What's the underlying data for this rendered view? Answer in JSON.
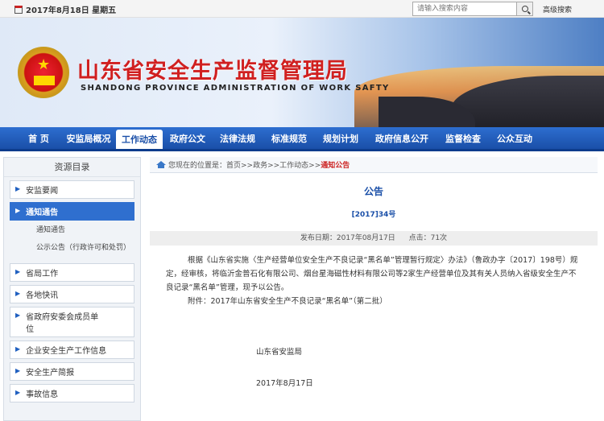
{
  "topbar": {
    "date": "2017年8月18日 星期五",
    "search_placeholder": "请输入搜索内容",
    "advanced_search": "高级搜索"
  },
  "banner": {
    "title_cn": "山东省安全生产监督管理局",
    "title_en": "SHANDONG PROVINCE ADMINISTRATION OF WORK SAFTY"
  },
  "nav": [
    {
      "label": "首  页"
    },
    {
      "label": "安监局概况"
    },
    {
      "label": "工作动态",
      "active": true
    },
    {
      "label": "政府公文"
    },
    {
      "label": "法律法规"
    },
    {
      "label": "标准规范"
    },
    {
      "label": "规划计划"
    },
    {
      "label": "政府信息公开"
    },
    {
      "label": "监督检查"
    },
    {
      "label": "公众互动"
    }
  ],
  "sidebar": {
    "title": "资源目录",
    "items": [
      {
        "label": "安监要闻"
      },
      {
        "label": "通知通告",
        "active": true
      },
      {
        "label": "省局工作"
      },
      {
        "label": "各地快讯"
      },
      {
        "label": "省政府安委会成员单位"
      },
      {
        "label": "企业安全生产工作信息"
      },
      {
        "label": "安全生产简报"
      },
      {
        "label": "事故信息"
      }
    ],
    "subitems": [
      {
        "label": "通知通告"
      },
      {
        "label": "公示公告（行政许可和处罚）"
      }
    ]
  },
  "breadcrumb": {
    "prefix": "您现在的位置是：首页>>政务>>工作动态>>",
    "current": "通知公告"
  },
  "article": {
    "title": "公告",
    "doc_no": "[2017]34号",
    "publish_date": "发布日期：2017年08月17日",
    "clicks": "点击：71次",
    "para1": "根据《山东省实施〈生产经营单位安全生产不良记录“黑名单”管理暂行规定〉办法》（鲁政办字〔2017〕198号）规定，经审核，将临沂金普石化有限公司、烟台星海磁性材料有限公司等2家生产经营单位及其有关人员纳入省级安全生产不良记录“黑名单”管理，现予以公告。",
    "para2": "附件：2017年山东省安全生产不良记录“黑名单”（第二批）",
    "signer": "山东省安监局",
    "sign_date": "2017年8月17日"
  }
}
